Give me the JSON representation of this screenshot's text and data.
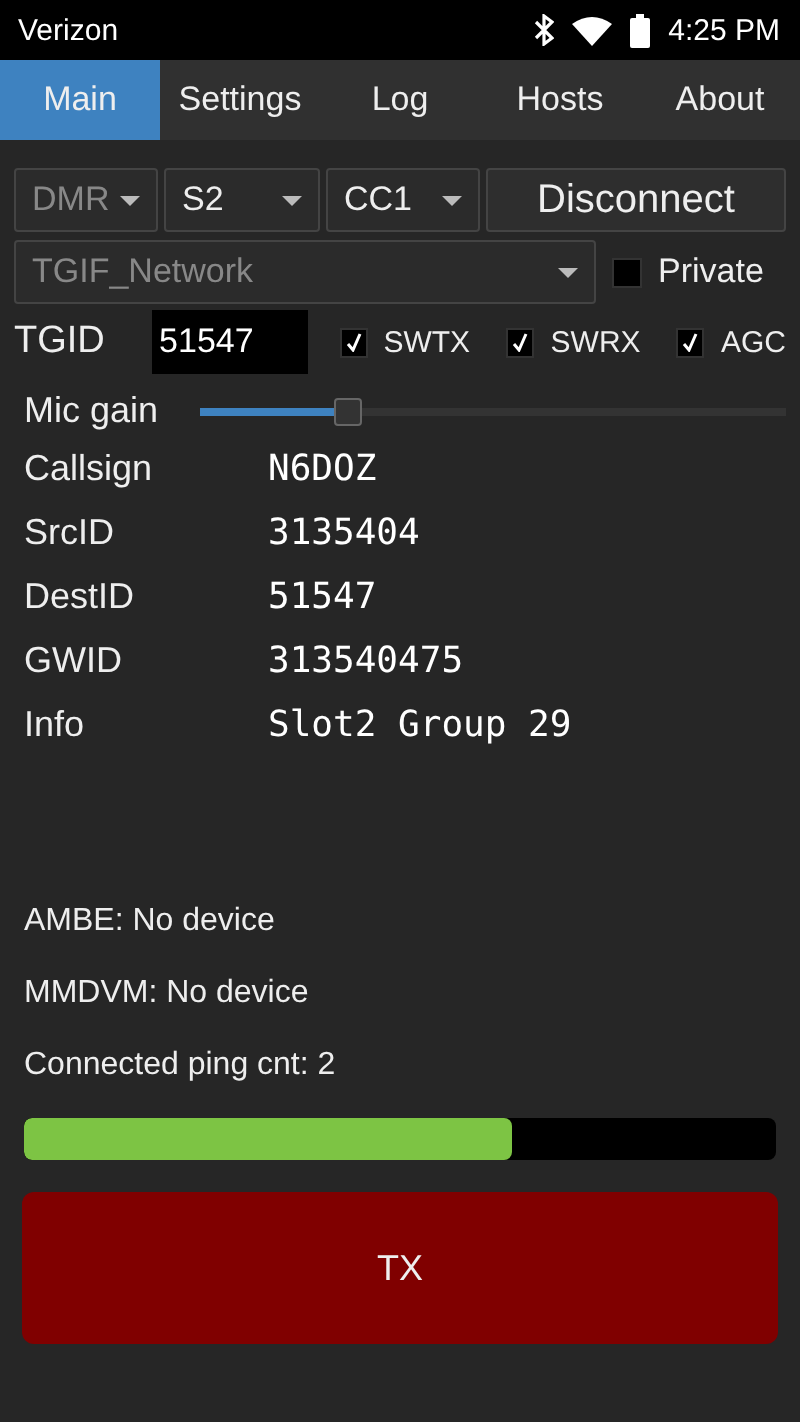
{
  "status_bar": {
    "carrier": "Verizon",
    "time": "4:25 PM"
  },
  "tabs": [
    {
      "label": "Main",
      "selected": true
    },
    {
      "label": "Settings",
      "selected": false
    },
    {
      "label": "Log",
      "selected": false
    },
    {
      "label": "Hosts",
      "selected": false
    },
    {
      "label": "About",
      "selected": false
    }
  ],
  "controls": {
    "dropdowns": [
      {
        "value": "DMR",
        "disabled": true
      },
      {
        "value": "S2",
        "disabled": false
      },
      {
        "value": "CC1",
        "disabled": false
      }
    ],
    "connect_button": "Disconnect",
    "network": {
      "value": "TGIF_Network",
      "disabled": true
    },
    "private": {
      "label": "Private",
      "checked": false
    },
    "tgid": {
      "label": "TGID",
      "value": "51547"
    },
    "options": [
      {
        "label": "SWTX",
        "checked": true
      },
      {
        "label": "SWRX",
        "checked": true
      },
      {
        "label": "AGC",
        "checked": true
      }
    ],
    "mic_gain": {
      "label": "Mic gain",
      "level": 0.25
    }
  },
  "info": [
    {
      "label": "Callsign",
      "value": "N6DOZ"
    },
    {
      "label": "SrcID",
      "value": "3135404"
    },
    {
      "label": "DestID",
      "value": "51547"
    },
    {
      "label": "GWID",
      "value": "313540475"
    },
    {
      "label": "Info",
      "value": "Slot2 Group 29"
    }
  ],
  "status_lines": [
    "AMBE: No device",
    "MMDVM: No device",
    "Connected ping cnt: 2"
  ],
  "progress": {
    "level": 0.65
  },
  "tx_button": "TX"
}
